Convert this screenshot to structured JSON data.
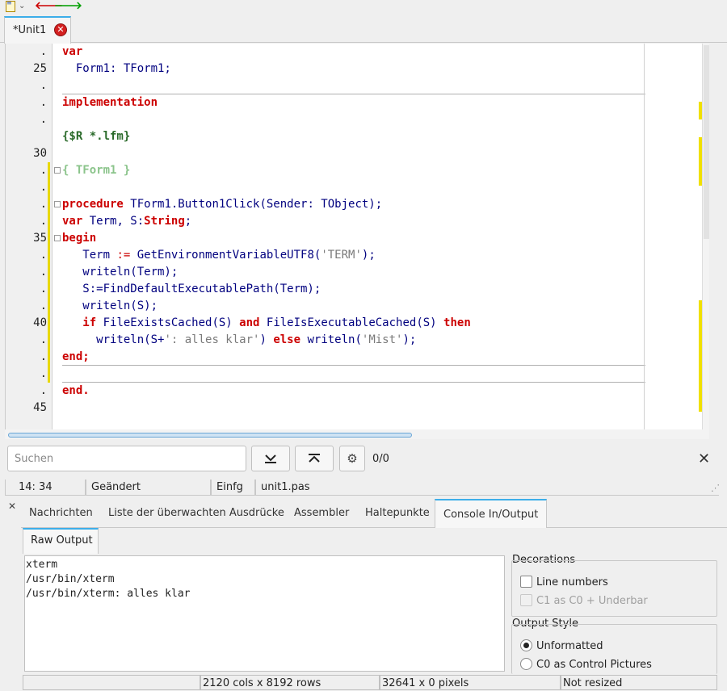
{
  "toolbar": {
    "back_icon": "arrow-left-icon",
    "forward_icon": "arrow-right-icon",
    "menu_icon": "document-list-icon",
    "colors": {
      "back": "#cc0000",
      "forward": "#00a000"
    }
  },
  "editor_tab": {
    "label": "*Unit1"
  },
  "gutter": {
    "lines": [
      ".",
      "25",
      ".",
      ".",
      ".",
      "30",
      ".",
      ".",
      ".",
      ".",
      "35",
      ".",
      ".",
      ".",
      ".",
      "40",
      ".",
      ".",
      ".",
      ".",
      "45"
    ]
  },
  "code": {
    "l1": "var",
    "l2": "  Form1: TForm1;",
    "l3": "implementation",
    "l4": "{$R *.lfm}",
    "l5": "{ TForm1 }",
    "l6_kw": "procedure",
    "l6_rest": "TForm1.Button1Click(Sender: TObject);",
    "l7_kw": "var",
    "l7_rest": "Term, S:",
    "l7_type": "String",
    "l7_end": ";",
    "l8": "begin",
    "l9_a": "   Term ",
    "l9_op": ":=",
    "l9_b": " GetEnvironmentVariableUTF8(",
    "l9_str": "'TERM'",
    "l9_c": ");",
    "l10": "   writeln(Term);",
    "l11": "   S:=FindDefaultExecutablePath(Term);",
    "l12": "   writeln(S);",
    "l13_if": "   if",
    "l13_a": " FileExistsCached(S) ",
    "l13_and": "and",
    "l13_b": " FileIsExecutableCached(S) ",
    "l13_then": "then",
    "l14_a": "     writeln(S+",
    "l14_str": "': alles klar'",
    "l14_b": ") ",
    "l14_else": "else",
    "l14_c": " writeln(",
    "l14_str2": "'Mist'",
    "l14_d": ");",
    "l15": "end;",
    "l16": "end."
  },
  "search": {
    "placeholder": "Suchen",
    "value": "",
    "count": "0/0"
  },
  "status": {
    "position": "14: 34",
    "state": "Geändert",
    "mode": "Einfg",
    "file": "unit1.pas"
  },
  "debug_tabs": [
    "Nachrichten",
    "Liste der überwachten Ausdrücke",
    "Assembler",
    "Haltepunkte",
    "Console In/Output"
  ],
  "sub_tab": "Raw Output",
  "console_lines": [
    "xterm",
    "/usr/bin/xterm",
    "/usr/bin/xterm: alles klar"
  ],
  "decorations": {
    "title": "Decorations",
    "line_numbers": "Line numbers",
    "c1": "C1 as C0 + Underbar"
  },
  "output_style": {
    "title": "Output Style",
    "unformatted": "Unformatted",
    "c0": "C0 as Control Pictures"
  },
  "bottom_status": {
    "cols_rows": "2120 cols x 8192 rows",
    "pixels": "32641 x 0 pixels",
    "resized": "Not resized"
  }
}
